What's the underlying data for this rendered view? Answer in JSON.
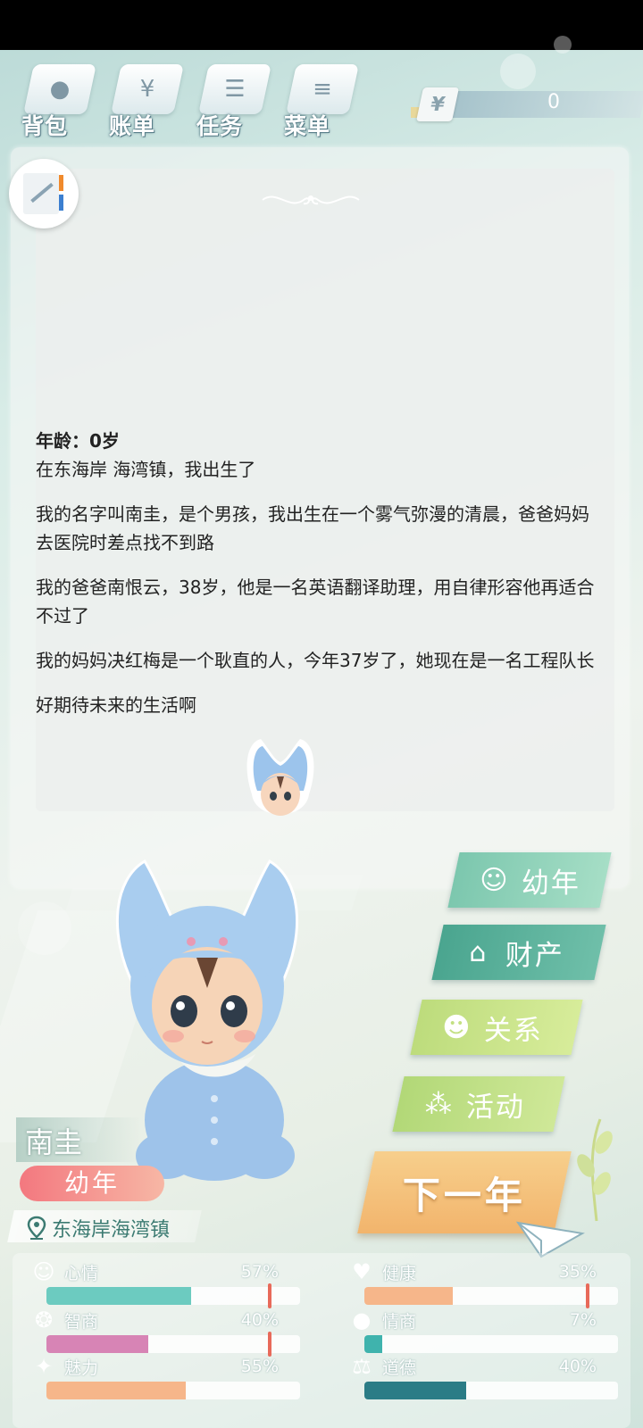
{
  "nav": {
    "items": [
      {
        "label": "背包",
        "icon": "backpack-icon"
      },
      {
        "label": "账单",
        "icon": "bill-icon"
      },
      {
        "label": "任务",
        "icon": "task-icon"
      },
      {
        "label": "菜单",
        "icon": "menu-icon"
      }
    ]
  },
  "currency": {
    "symbol": "¥",
    "value": "0"
  },
  "story": {
    "age": "年龄：0岁",
    "lines": [
      "在东海岸 海湾镇，我出生了",
      "我的名字叫南圭，是个男孩，我出生在一个雾气弥漫的清晨，爸爸妈妈去医院时差点找不到路",
      "我的爸爸南恨云，38岁，他是一名英语翻译助理，用自律形容他再适合不过了",
      "我的妈妈决红梅是一个耿直的人，今年37岁了，她现在是一名工程队长",
      "好期待未来的生活啊"
    ]
  },
  "tabs": {
    "youth": "幼年",
    "assets": "财产",
    "relations": "关系",
    "activity": "活动"
  },
  "next_year": "下一年",
  "character": {
    "name": "南圭",
    "stage": "幼年",
    "location": "东海岸海湾镇"
  },
  "stats": [
    {
      "label": "心情",
      "pct_text": "57%",
      "value": 0.57,
      "color": "#6ccbc0",
      "icon": "smile-icon"
    },
    {
      "label": "健康",
      "pct_text": "35%",
      "value": 0.35,
      "color": "#f6b68a",
      "icon": "heart-icon"
    },
    {
      "label": "智商",
      "pct_text": "40%",
      "value": 0.4,
      "color": "#d784b5",
      "icon": "brain-icon"
    },
    {
      "label": "情商",
      "pct_text": "7%",
      "value": 0.07,
      "color": "#3fb3ad",
      "icon": "apple-icon"
    },
    {
      "label": "魅力",
      "pct_text": "55%",
      "value": 0.55,
      "color": "#f6b68a",
      "icon": "sparkle-icon"
    },
    {
      "label": "道德",
      "pct_text": "40%",
      "value": 0.4,
      "color": "#2b7c86",
      "icon": "scale-icon"
    }
  ]
}
